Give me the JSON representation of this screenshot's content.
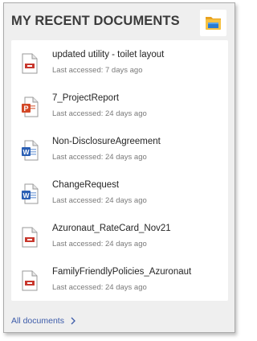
{
  "header": {
    "title": "MY RECENT DOCUMENTS",
    "folder_button_icon": "file-explorer-folder-icon"
  },
  "documents": [
    {
      "name": "updated utility - toilet layout",
      "last_accessed": "Last accessed: 7 days ago",
      "type": "pdf",
      "icon": "pdf-file-icon"
    },
    {
      "name": "7_ProjectReport",
      "last_accessed": "Last accessed: 24 days ago",
      "type": "powerpoint",
      "icon": "powerpoint-file-icon"
    },
    {
      "name": "Non-DisclosureAgreement",
      "last_accessed": "Last accessed: 24 days ago",
      "type": "word",
      "icon": "word-file-icon"
    },
    {
      "name": "ChangeRequest",
      "last_accessed": "Last accessed: 24 days ago",
      "type": "word",
      "icon": "word-file-icon"
    },
    {
      "name": "Azuronaut_RateCard_Nov21",
      "last_accessed": "Last accessed: 24 days ago",
      "type": "pdf",
      "icon": "pdf-file-icon"
    },
    {
      "name": "FamilyFriendlyPolicies_Azuronaut",
      "last_accessed": "Last accessed: 24 days ago",
      "type": "pdf",
      "icon": "pdf-file-icon"
    }
  ],
  "footer": {
    "all_documents_label": "All documents",
    "chevron_icon": "chevron-right-icon"
  },
  "colors": {
    "panel_bg": "#efefef",
    "card_bg": "#ffffff",
    "link": "#3c5ba9",
    "pdf_red": "#c8372d",
    "ppt_orange": "#d24726",
    "word_blue": "#2b5fb4"
  }
}
